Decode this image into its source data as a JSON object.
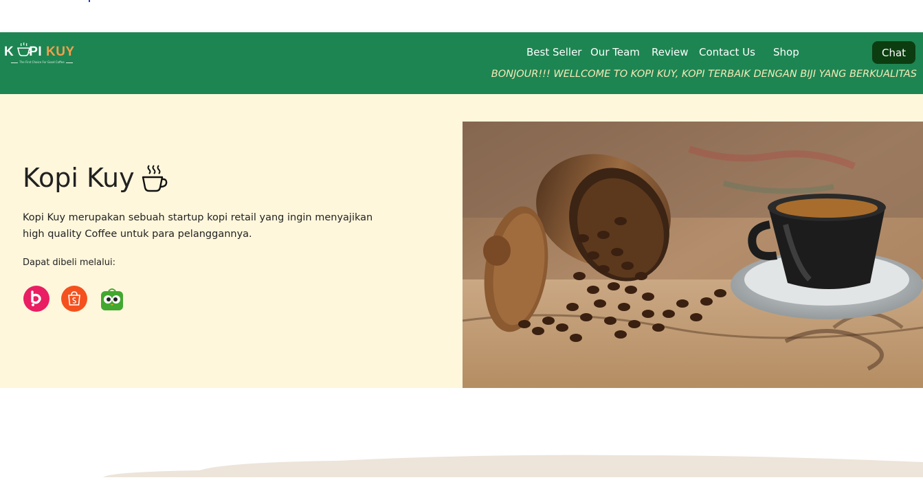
{
  "brand": {
    "logo_part1": "K",
    "logo_part2": "PI ",
    "logo_part3": "KUY",
    "tagline": "The First Choice For Good Coffee",
    "brand_color": "#1d8552",
    "accent_color": "#f4a04b"
  },
  "nav": {
    "items": [
      {
        "label": "Best Seller"
      },
      {
        "label": "Our Team"
      },
      {
        "label": "Review"
      },
      {
        "label": "Contact Us"
      },
      {
        "label": "Shop"
      }
    ],
    "chat_label": "Chat",
    "chat_color": "#0c3d10",
    "marquee_text": "BONJOUR!!! WELLCOME TO KOPI KUY, KOPI TERBAIK DENGAN BIJI YANG BERKUALITAS"
  },
  "hero": {
    "title": "Kopi Kuy",
    "title_icon": "coffee-cup-icon",
    "description": "Kopi Kuy merupakan sebuah startup kopi retail yang ingin menyajikan high quality Coffee untuk para pelanggannya.",
    "buy_label": "Dapat dibeli melalui:",
    "background": "#fef7dc",
    "shops": [
      {
        "icon": "blibli-icon",
        "color": "#e91e63"
      },
      {
        "icon": "shopee-icon",
        "color": "#f4511e"
      },
      {
        "icon": "tokopedia-icon",
        "color": "#42a82f"
      }
    ],
    "image": "coffee-beans-and-cup-photo"
  }
}
